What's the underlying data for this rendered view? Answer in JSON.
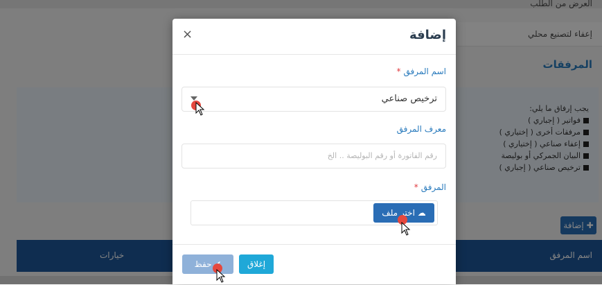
{
  "background": {
    "top_text": "العرض من الطلب",
    "exemption_label": "إعفاء لتصنيع محلي",
    "attachments_heading": "المرفقات",
    "requirements_intro": "يجب إرفاق ما يلي:",
    "requirements": [
      "فواتير ( إجباري )",
      "مرفقات أخرى ( إختياري )",
      "إعفاء صناعي ( إختياري )",
      "البيان الجمركي أو بوليصة",
      "ترخيص صناعي ( إجباري )"
    ],
    "add_button": "إضافة",
    "table_headers": {
      "attachment_name": "اسم المرفق",
      "options": "خيارات"
    }
  },
  "modal": {
    "title": "إضافة",
    "close_symbol": "×",
    "attachment_name_label": "اسم المرفق",
    "attachment_name_value": "ترخيص صناعي",
    "attachment_id_label": "معرف المرفق",
    "attachment_id_placeholder": "رقم الفاتورة أو رقم البوليصة .. الخ",
    "file_label": "المرفق",
    "required_mark": "*",
    "choose_file_button": "اختر ملف",
    "save_button": "حفظ",
    "close_button": "إغلاق"
  },
  "colors": {
    "primary": "#2a6db5",
    "label": "#2a7bbd",
    "save_disabled": "#8fb1d9",
    "close_footer": "#1fa8d8",
    "required": "#e0393e",
    "click_marker": "#e5483e"
  }
}
